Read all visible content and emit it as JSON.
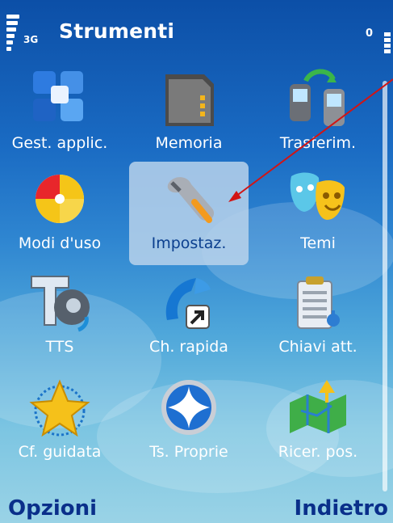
{
  "status": {
    "network": "3G",
    "indicator": "0"
  },
  "title": "Strumenti",
  "grid": [
    {
      "label": "Gest. applic.",
      "icon": "app-manager-icon"
    },
    {
      "label": "Memoria",
      "icon": "memory-card-icon"
    },
    {
      "label": "Trasferim.",
      "icon": "transfer-phones-icon"
    },
    {
      "label": "Modi d'uso",
      "icon": "profiles-icon"
    },
    {
      "label": "Impostaz.",
      "icon": "settings-wrench-icon",
      "selected": true
    },
    {
      "label": "Temi",
      "icon": "theme-masks-icon"
    },
    {
      "label": "TTS",
      "icon": "tts-icon"
    },
    {
      "label": "Ch. rapida",
      "icon": "speed-dial-icon"
    },
    {
      "label": "Chiavi att.",
      "icon": "activation-keys-icon"
    },
    {
      "label": "Cf. guidata",
      "icon": "guided-setup-star-icon"
    },
    {
      "label": "Ts. Proprie",
      "icon": "own-key-icon"
    },
    {
      "label": "Ricer. pos.",
      "icon": "positioning-map-icon"
    }
  ],
  "softkeys": {
    "left": "Opzioni",
    "right": "Indietro"
  },
  "colors": {
    "background_top": "#0c4fa7",
    "background_bottom": "#9ad3e6",
    "selection": "#b9d2eb",
    "softkey_text": "#0a2f8a",
    "annotation_arrow": "#d21414"
  }
}
